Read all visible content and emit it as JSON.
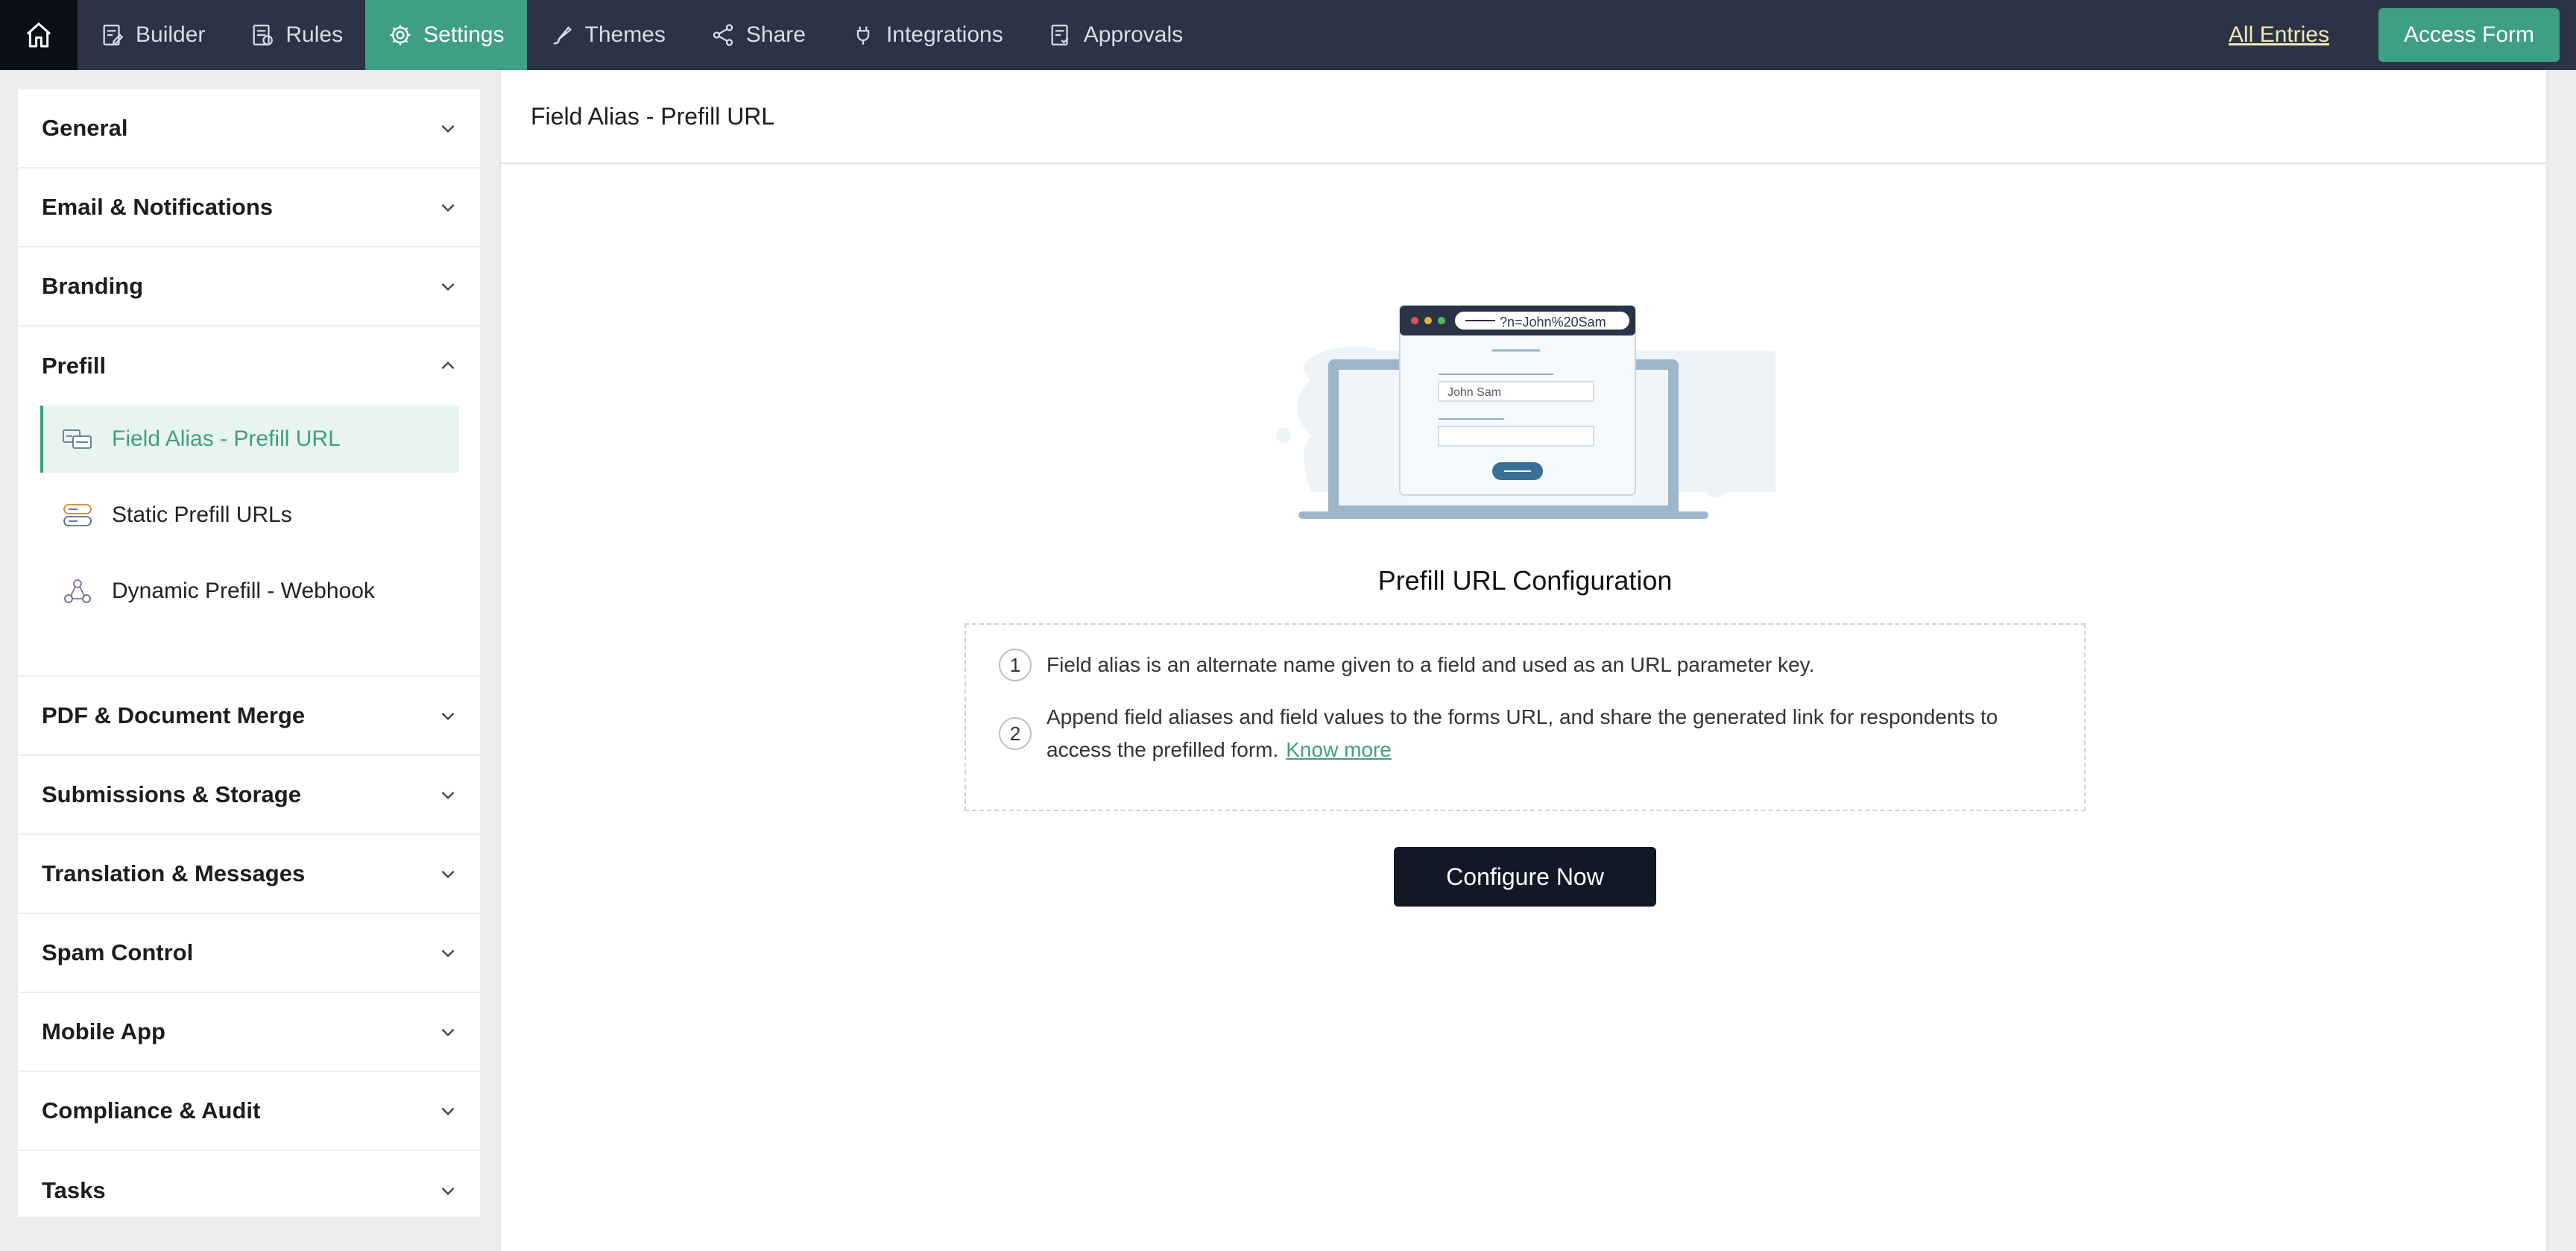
{
  "topbar": {
    "home_icon": "home-icon",
    "nav": [
      {
        "label": "Builder",
        "icon": "builder-icon"
      },
      {
        "label": "Rules",
        "icon": "rules-icon"
      },
      {
        "label": "Settings",
        "icon": "gear-icon"
      },
      {
        "label": "Themes",
        "icon": "brush-icon"
      },
      {
        "label": "Share",
        "icon": "share-icon"
      },
      {
        "label": "Integrations",
        "icon": "plug-icon"
      },
      {
        "label": "Approvals",
        "icon": "approvals-icon"
      }
    ],
    "active_nav": "Settings",
    "all_entries": "All Entries",
    "access_form": "Access Form"
  },
  "sidebar": {
    "sections_top": [
      "General",
      "Email & Notifications",
      "Branding"
    ],
    "prefill": {
      "title": "Prefill",
      "items": [
        {
          "label": "Field Alias - Prefill URL",
          "icon": "field-alias-icon",
          "active": true
        },
        {
          "label": "Static Prefill URLs",
          "icon": "static-prefill-icon",
          "active": false
        },
        {
          "label": "Dynamic Prefill - Webhook",
          "icon": "webhook-icon",
          "active": false
        }
      ]
    },
    "sections_bottom": [
      "PDF & Document Merge",
      "Submissions & Storage",
      "Translation & Messages",
      "Spam Control",
      "Mobile App",
      "Compliance & Audit",
      "Tasks"
    ]
  },
  "main": {
    "header": "Field Alias - Prefill URL",
    "illustration": {
      "url_text": "?n=John%20Sam",
      "field_value": "John Sam"
    },
    "config_title": "Prefill URL Configuration",
    "steps": [
      {
        "num": "1",
        "text": "Field alias is an alternate name given to a field and used as an URL parameter key."
      },
      {
        "num": "2",
        "text": "Append field aliases and field values to the forms URL, and share the generated link for respondents to access the prefilled form.",
        "link": "Know more"
      }
    ],
    "configure_button": "Configure Now"
  },
  "colors": {
    "topbar": "#2b3446",
    "accent": "#3f9f84",
    "dark_button": "#121826"
  }
}
